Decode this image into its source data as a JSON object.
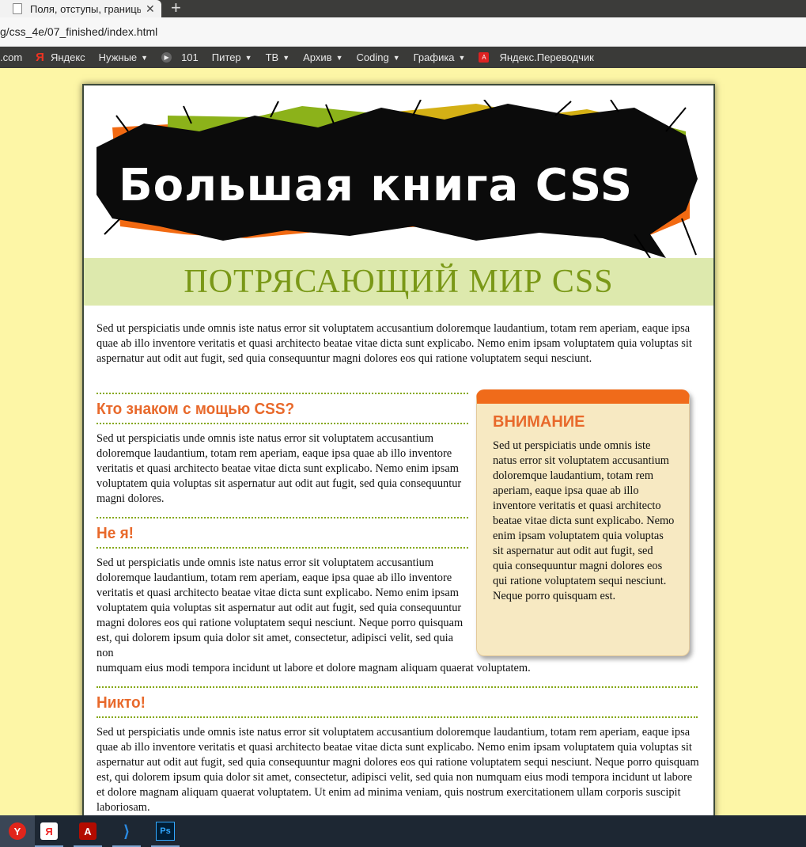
{
  "browser": {
    "tab_title": "Поля, отступы, границы",
    "tab_close": "✕",
    "new_tab": "+",
    "url": "g/css_4e/07_finished/index.html",
    "bookmarks": [
      {
        "label": ".com",
        "icon": "",
        "dropdown": false
      },
      {
        "label": "Яндекс",
        "icon": "yandex-icon",
        "dropdown": false
      },
      {
        "label": "Нужные",
        "icon": "",
        "dropdown": true
      },
      {
        "label": "101",
        "icon": "circle-play-icon",
        "dropdown": false
      },
      {
        "label": "Питер",
        "icon": "",
        "dropdown": true
      },
      {
        "label": "ТВ",
        "icon": "",
        "dropdown": true
      },
      {
        "label": "Архив",
        "icon": "",
        "dropdown": true
      },
      {
        "label": "Coding",
        "icon": "",
        "dropdown": true
      },
      {
        "label": "Графика",
        "icon": "",
        "dropdown": true
      },
      {
        "label": "Яндекс.Переводчик",
        "icon": "translate-icon",
        "dropdown": false
      }
    ]
  },
  "page": {
    "banner_title": "Большая книга CSS",
    "subheading": "ПОТРЯСАЮЩИЙ МИР CSS",
    "intro": "Sed ut perspiciatis unde omnis iste natus error sit voluptatem accusantium doloremque laudantium, totam rem aperiam, eaque ipsa quae ab illo inventore veritatis et quasi architecto beatae vitae dicta sunt explicabo. Nemo enim ipsam voluptatem quia voluptas sit aspernatur aut odit aut fugit, sed quia consequuntur magni dolores eos qui ratione voluptatem sequi nesciunt.",
    "sections": [
      {
        "heading": "Кто знаком с мощью CSS?",
        "text": "Sed ut perspiciatis unde omnis iste natus error sit voluptatem accusantium doloremque laudantium, totam rem aperiam, eaque ipsa quae ab illo inventore veritatis et quasi architecto beatae vitae dicta sunt explicabo. Nemo enim ipsam voluptatem quia voluptas sit aspernatur aut odit aut fugit, sed quia consequuntur magni dolores."
      },
      {
        "heading": "Не я!",
        "text_wrapped": "Sed ut perspiciatis unde omnis iste natus error sit voluptatem accusantium doloremque laudantium, totam rem aperiam, eaque ipsa quae ab illo inventore veritatis et quasi architecto beatae vitae dicta sunt explicabo. Nemo enim ipsam voluptatem quia voluptas sit aspernatur aut odit aut fugit, sed quia consequuntur magni dolores eos qui ratione voluptatem sequi nesciunt. Neque porro quisquam est, qui dolorem ipsum quia dolor sit amet, consectetur, adipisci velit, sed quia non",
        "text_tail": "numquam eius modi tempora incidunt ut labore et dolore magnam aliquam quaerat voluptatem."
      },
      {
        "heading": "Никто!",
        "text": "Sed ut perspiciatis unde omnis iste natus error sit voluptatem accusantium doloremque laudantium, totam rem aperiam, eaque ipsa quae ab illo inventore veritatis et quasi architecto beatae vitae dicta sunt explicabo. Nemo enim ipsam voluptatem quia voluptas sit aspernatur aut odit aut fugit, sed quia consequuntur magni dolores eos qui ratione voluptatem sequi nesciunt. Neque porro quisquam est, qui dolorem ipsum quia dolor sit amet, consectetur, adipisci velit, sed quia non numquam eius modi tempora incidunt ut labore et dolore magnam aliquam quaerat voluptatem. Ut enim ad minima veniam, quis nostrum exercitationem ullam corporis suscipit laboriosam."
      }
    ],
    "sidebar": {
      "title": "ВНИМАНИЕ",
      "text": "Sed ut perspiciatis unde omnis iste natus error sit voluptatem accusantium doloremque laudantium, totam rem aperiam, eaque ipsa quae ab illo inventore veritatis et quasi architecto beatae vitae dicta sunt explicabo. Nemo enim ipsam voluptatem quia voluptas sit aspernatur aut odit aut fugit, sed quia consequuntur magni dolores eos qui ratione voluptatem sequi nesciunt. Neque porro quisquam est."
    }
  },
  "taskbar": {
    "apps": [
      {
        "name": "yandex-browser-icon",
        "glyph": "Y",
        "color": "#e1251b",
        "active": true
      },
      {
        "name": "yandex-icon",
        "glyph": "Я",
        "color": "#ffffff",
        "active": false
      },
      {
        "name": "acrobat-icon",
        "glyph": "A",
        "color": "#b30b00",
        "active": false
      },
      {
        "name": "vscode-icon",
        "glyph": "⟩",
        "color": "#2a8ae2",
        "active": false
      },
      {
        "name": "photoshop-icon",
        "glyph": "Ps",
        "color": "#31a8ff",
        "active": false
      }
    ]
  },
  "colors": {
    "page_bg": "#fdf6a6",
    "accent_orange": "#e8692b",
    "accent_green": "#7a9817",
    "subhead_bg": "#dde9ad",
    "sidebar_bg": "#f7e9c2",
    "sidebar_top": "#f06b1a"
  }
}
